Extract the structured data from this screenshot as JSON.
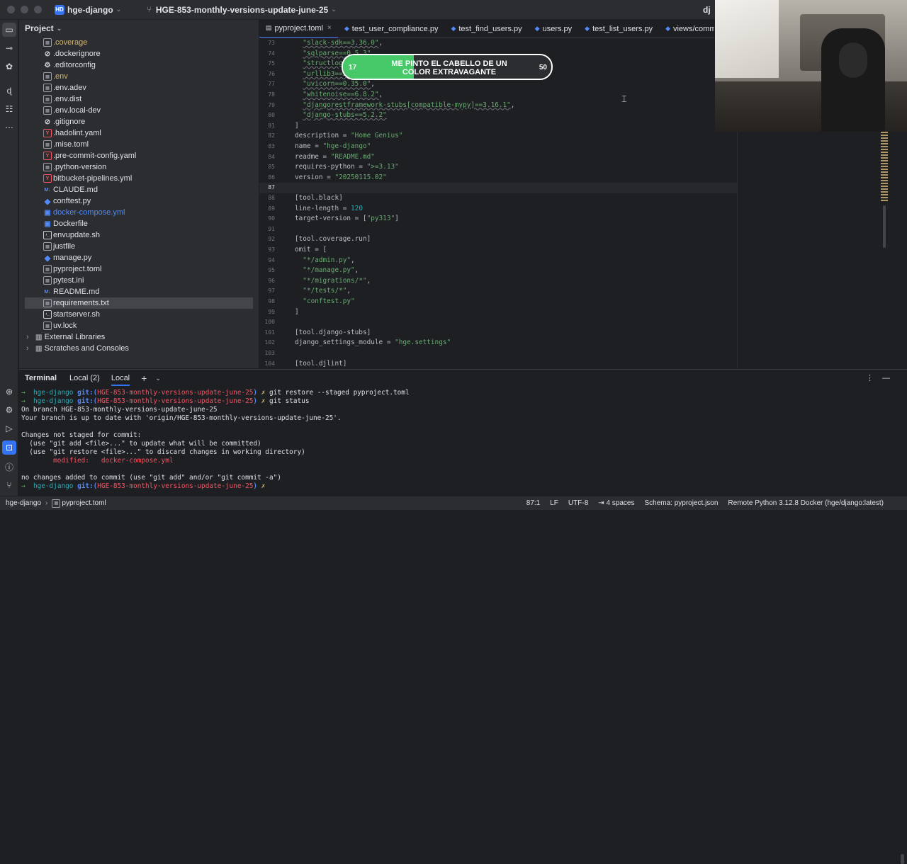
{
  "titlebar": {
    "project_badge": "HD",
    "project_name": "hge-django",
    "branch": "HGE-853-monthly-versions-update-june-25",
    "right_label": "dj"
  },
  "project_panel": {
    "title": "Project",
    "files": [
      {
        "name": ".coverage",
        "icon": "text-file-icon",
        "color": "yellow"
      },
      {
        "name": ".dockerignore",
        "icon": "ban-icon",
        "color": "default"
      },
      {
        "name": ".editorconfig",
        "icon": "gear-icon",
        "color": "default"
      },
      {
        "name": ".env",
        "icon": "text-file-icon",
        "color": "yellow"
      },
      {
        "name": ".env.adev",
        "icon": "text-file-icon",
        "color": "default"
      },
      {
        "name": ".env.dist",
        "icon": "text-file-icon",
        "color": "default"
      },
      {
        "name": ".env.local-dev",
        "icon": "text-file-icon",
        "color": "default"
      },
      {
        "name": ".gitignore",
        "icon": "ban-icon",
        "color": "default"
      },
      {
        "name": ".hadolint.yaml",
        "icon": "yaml-icon",
        "color": "default"
      },
      {
        "name": ".mise.toml",
        "icon": "text-file-icon",
        "color": "default"
      },
      {
        "name": ".pre-commit-config.yaml",
        "icon": "yaml-icon",
        "color": "default"
      },
      {
        "name": ".python-version",
        "icon": "text-file-icon",
        "color": "default"
      },
      {
        "name": "bitbucket-pipelines.yml",
        "icon": "yaml-icon",
        "color": "default"
      },
      {
        "name": "CLAUDE.md",
        "icon": "markdown-icon",
        "color": "default"
      },
      {
        "name": "conftest.py",
        "icon": "python-icon",
        "color": "default"
      },
      {
        "name": "docker-compose.yml",
        "icon": "docker-icon",
        "color": "blue"
      },
      {
        "name": "Dockerfile",
        "icon": "docker-icon",
        "color": "default"
      },
      {
        "name": "envupdate.sh",
        "icon": "shell-icon",
        "color": "default"
      },
      {
        "name": "justfile",
        "icon": "text-file-icon",
        "color": "default"
      },
      {
        "name": "manage.py",
        "icon": "python-icon",
        "color": "default"
      },
      {
        "name": "pyproject.toml",
        "icon": "text-file-icon",
        "color": "default"
      },
      {
        "name": "pytest.ini",
        "icon": "text-file-icon",
        "color": "default"
      },
      {
        "name": "README.md",
        "icon": "markdown-icon",
        "color": "default"
      },
      {
        "name": "requirements.txt",
        "icon": "text-file-icon",
        "color": "default",
        "selected": true
      },
      {
        "name": "startserver.sh",
        "icon": "shell-icon",
        "color": "default"
      },
      {
        "name": "uv.lock",
        "icon": "text-file-icon",
        "color": "default"
      }
    ],
    "external_libraries": "External Libraries",
    "scratches": "Scratches and Consoles"
  },
  "tabs": [
    {
      "label": "pyproject.toml",
      "icon": "toml",
      "active": true,
      "close": "×"
    },
    {
      "label": "test_user_compliance.py",
      "icon": "py"
    },
    {
      "label": "test_find_users.py",
      "icon": "py"
    },
    {
      "label": "users.py",
      "icon": "py"
    },
    {
      "label": "test_list_users.py",
      "icon": "py"
    },
    {
      "label": "views/commissio",
      "icon": "py"
    }
  ],
  "editor": {
    "lines": [
      {
        "n": "73",
        "html": "  <span class=\"s u\">\"slack-sdk==3.36.0\"</span>,"
      },
      {
        "n": "74",
        "html": "  <span class=\"s u\">\"sqlparse==0.5.3\"</span>,"
      },
      {
        "n": "75",
        "html": "  <span class=\"s u\">\"structlog==25.4.0\"</span>,"
      },
      {
        "n": "76",
        "html": "  <span class=\"s u\">\"urllib3==2.5.0\"</span>,"
      },
      {
        "n": "77",
        "html": "  <span class=\"s u\">\"uvicorn==0.35.0\"</span>,"
      },
      {
        "n": "78",
        "html": "  <span class=\"s u\">\"whitenoise==6.8.2\"</span>,"
      },
      {
        "n": "79",
        "html": "  <span class=\"s u\">\"djangorestframework-stubs[compatible-mypy]==3.16.1\"</span>,"
      },
      {
        "n": "80",
        "html": "  <span class=\"s u\">\"django-stubs==5.2.2\"</span>"
      },
      {
        "n": "81",
        "html": "]"
      },
      {
        "n": "82",
        "html": "description = <span class=\"s\">\"Home Genius\"</span>"
      },
      {
        "n": "83",
        "html": "name = <span class=\"s\">\"hge-django\"</span>"
      },
      {
        "n": "84",
        "html": "readme = <span class=\"s\">\"README.md\"</span>"
      },
      {
        "n": "85",
        "html": "requires-python = <span class=\"s\">\"&gt;=3.13\"</span>"
      },
      {
        "n": "86",
        "html": "version = <span class=\"s\">\"20250115.02\"</span>"
      },
      {
        "n": "87",
        "html": "",
        "current": true
      },
      {
        "n": "88",
        "html": "[tool.black]"
      },
      {
        "n": "89",
        "html": "line-length = <span class=\"n\">120</span>"
      },
      {
        "n": "90",
        "html": "target-version = [<span class=\"s\">\"py313\"</span>]"
      },
      {
        "n": "91",
        "html": ""
      },
      {
        "n": "92",
        "html": "[tool.coverage.run]"
      },
      {
        "n": "93",
        "html": "omit = ["
      },
      {
        "n": "94",
        "html": "  <span class=\"s\">\"*/admin.py\"</span>,"
      },
      {
        "n": "95",
        "html": "  <span class=\"s\">\"*/manage.py\"</span>,"
      },
      {
        "n": "96",
        "html": "  <span class=\"s\">\"*/migrations/*\"</span>,"
      },
      {
        "n": "97",
        "html": "  <span class=\"s\">\"*/tests/*\"</span>,"
      },
      {
        "n": "98",
        "html": "  <span class=\"s\">\"conftest.py\"</span>"
      },
      {
        "n": "99",
        "html": "]"
      },
      {
        "n": "100",
        "html": ""
      },
      {
        "n": "101",
        "html": "[tool.django-stubs]"
      },
      {
        "n": "102",
        "html": "django_settings_module = <span class=\"s\">\"hge.settings\"</span>"
      },
      {
        "n": "103",
        "html": ""
      },
      {
        "n": "104",
        "html": "[tool.djlint]"
      }
    ]
  },
  "overlay_popup": {
    "left_value": "17",
    "text_line1": "ME PINTO EL CABELLO DE UN",
    "text_line2": "COLOR EXTRAVAGANTE",
    "right_value": "50",
    "progress": 0.34
  },
  "terminal": {
    "title": "Terminal",
    "tabs": [
      "Local (2)",
      "Local"
    ],
    "plus": "+",
    "lines": [
      {
        "html": "<span class=\"t-green\">→</span>  <span class=\"t-cyan\">hge-django</span> <span class=\"t-blue\">git:(</span><span class=\"t-red\">HGE-853-monthly-versions-update-june-25</span><span class=\"t-blue\">)</span> <span class=\"t-yellow\">✗</span> git restore --staged pyproject.toml"
      },
      {
        "html": "<span class=\"t-green\">→</span>  <span class=\"t-cyan\">hge-django</span> <span class=\"t-blue\">git:(</span><span class=\"t-red\">HGE-853-monthly-versions-update-june-25</span><span class=\"t-blue\">)</span> <span class=\"t-yellow\">✗</span> git status"
      },
      {
        "html": "On branch HGE-853-monthly-versions-update-june-25"
      },
      {
        "html": "Your branch is up to date with 'origin/HGE-853-monthly-versions-update-june-25'."
      },
      {
        "html": ""
      },
      {
        "html": "Changes not staged for commit:"
      },
      {
        "html": "  (use \"git add &lt;file&gt;...\" to update what will be committed)"
      },
      {
        "html": "  (use \"git restore &lt;file&gt;...\" to discard changes in working directory)"
      },
      {
        "html": "        <span class=\"t-red\">modified:   docker-compose.yml</span>"
      },
      {
        "html": ""
      },
      {
        "html": "no changes added to commit (use \"git add\" and/or \"git commit -a\")"
      },
      {
        "html": "<span class=\"t-green\">→</span>  <span class=\"t-cyan\">hge-django</span> <span class=\"t-blue\">git:(</span><span class=\"t-red\">HGE-853-monthly-versions-update-june-25</span><span class=\"t-blue\">)</span> <span class=\"t-yellow\">✗</span> "
      }
    ]
  },
  "statusbar": {
    "project": "hge-django",
    "file": "pyproject.toml",
    "position": "87:1",
    "line_ending": "LF",
    "encoding": "UTF-8",
    "indent": "4 spaces",
    "schema": "Schema: pyproject.json",
    "interpreter": "Remote Python 3.12.8 Docker (hge/django:latest)"
  }
}
